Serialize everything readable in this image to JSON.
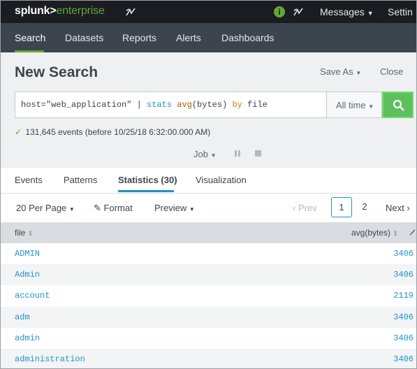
{
  "topbar": {
    "logo_main": "splunk>",
    "logo_sub": "enterprise",
    "health_glyph": "i",
    "messages": "Messages",
    "settings": "Settin",
    "accent": "#65a637"
  },
  "nav": {
    "tabs": [
      {
        "label": "Search",
        "active": true
      },
      {
        "label": "Datasets"
      },
      {
        "label": "Reports"
      },
      {
        "label": "Alerts"
      },
      {
        "label": "Dashboards"
      }
    ]
  },
  "header": {
    "title": "New Search",
    "save_as": "Save As",
    "close": "Close"
  },
  "search": {
    "query_prefix": "host=\"web_application\" | ",
    "query_cmd": "stats",
    "query_fn": "avg",
    "query_arg": "(bytes)",
    "query_kw": "by",
    "query_field": "file",
    "time_range": "All time",
    "button_color": "#5cc05c"
  },
  "status": {
    "text": "131,645 events (before 10/25/18 6:32:00.000 AM)"
  },
  "job": {
    "label": "Job"
  },
  "result_tabs": [
    {
      "label": "Events"
    },
    {
      "label": "Patterns"
    },
    {
      "label": "Statistics (30)",
      "active": true
    },
    {
      "label": "Visualization"
    }
  ],
  "toolbar": {
    "per_page": "20 Per Page",
    "format": "Format",
    "preview": "Preview",
    "prev": "Prev",
    "pages": [
      "1",
      "2"
    ],
    "next": "Next"
  },
  "table": {
    "columns": [
      "file",
      "avg(bytes)"
    ],
    "rows": [
      {
        "file": "ADMIN",
        "avg": "3406"
      },
      {
        "file": "Admin",
        "avg": "3406"
      },
      {
        "file": "account",
        "avg": "2119"
      },
      {
        "file": "adm",
        "avg": "3406"
      },
      {
        "file": "admin",
        "avg": "3406"
      },
      {
        "file": "administration",
        "avg": "3406"
      }
    ]
  }
}
